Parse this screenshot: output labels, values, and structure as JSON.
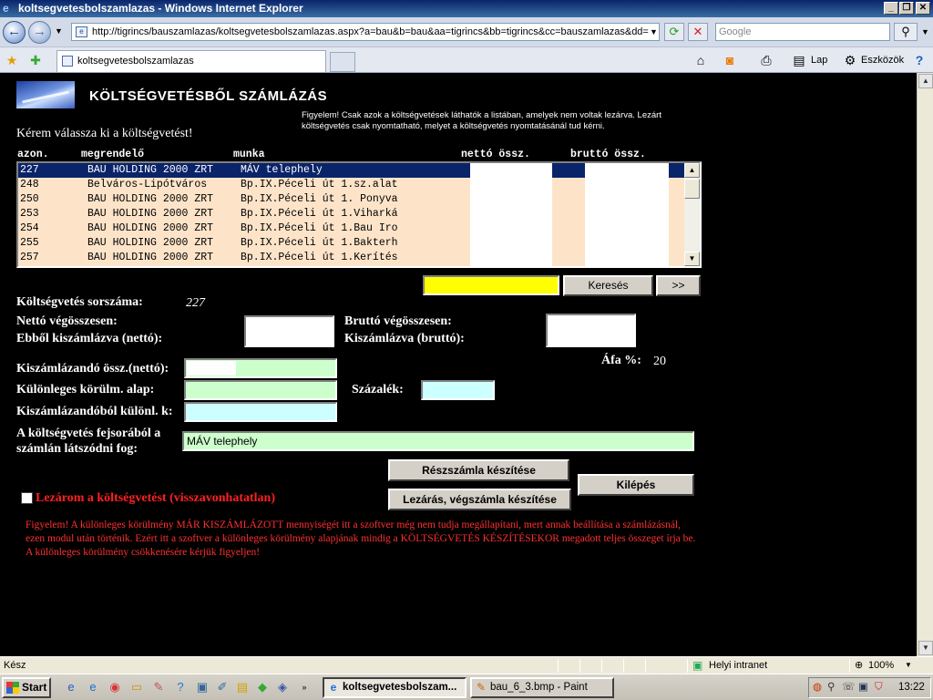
{
  "window": {
    "title": "koltsegvetesbolszamlazas - Windows Internet Explorer"
  },
  "browser": {
    "url": "http://tigrincs/bauszamlazas/koltsegvetesbolszamlazas.aspx?a=bau&b=bau&aa=tigrincs&bb=tigrincs&cc=bauszamlazas&dd=",
    "search_placeholder": "Google",
    "tab_title": "koltsegvetesbolszamlazas",
    "toolbar": {
      "page": "Lap",
      "tools": "Eszközök"
    }
  },
  "page": {
    "title": "KÖLTSÉGVETÉSBŐL SZÁMLÁZÁS",
    "notice": "Figyelem! Csak azok a költségvetések láthatók a listában, amelyek nem voltak lezárva. Lezárt költségvetés csak nyomtatható, melyet a költségvetés nyomtatásánál tud kérni.",
    "choose_prompt": "Kérem válassza ki a költségvetést!",
    "columns": {
      "id": "azon.",
      "customer": "megrendelő",
      "work": "munka",
      "net": "nettó össz.",
      "gross": "bruttó össz."
    },
    "rows": [
      {
        "id": "227",
        "customer": "BAU HOLDING 2000 ZRT",
        "work": "MÁV telephely"
      },
      {
        "id": "248",
        "customer": "Belváros-Lipótváros",
        "work": "Bp.IX.Péceli út 1.sz.alat"
      },
      {
        "id": "250",
        "customer": "BAU HOLDING 2000 ZRT",
        "work": "Bp.IX.Péceli út 1. Ponyva"
      },
      {
        "id": "253",
        "customer": "BAU HOLDING 2000 ZRT",
        "work": "Bp.IX.Péceli út 1.Viharká"
      },
      {
        "id": "254",
        "customer": "BAU HOLDING 2000 ZRT",
        "work": "Bp.IX.Péceli út 1.Bau Iro"
      },
      {
        "id": "255",
        "customer": "BAU HOLDING 2000 ZRT",
        "work": "Bp.IX.Péceli út 1.Bakterh"
      },
      {
        "id": "257",
        "customer": "BAU HOLDING 2000 ZRT",
        "work": "Bp.IX.Péceli út 1.Kerítés"
      }
    ],
    "search_button": "Keresés",
    "next_button": ">>",
    "budget_number_label": "Költségvetés sorszáma:",
    "budget_number_value": "227",
    "net_total_label": "Nettó végösszesen:",
    "net_invoiced_label": "Ebből kiszámlázva (nettó):",
    "gross_total_label": "Bruttó végösszesen:",
    "gross_invoiced_label": "Kiszámlázva (bruttó):",
    "vat_label": "Áfa %:",
    "vat_value": "20",
    "to_invoice_label": "Kiszámlázandó össz.(nettó):",
    "special_base_label": "Különleges körülm. alap:",
    "percent_label": "Százalék:",
    "special_from_label": "Kiszámlázandóból különl. k:",
    "header_text_label": "A költségvetés fejsorából a számlán látszódni fog:",
    "header_text_value": "MÁV telephely",
    "partial_invoice_button": "Részszámla készítése",
    "final_invoice_button": "Lezárás, végszámla készítése",
    "exit_button": "Kilépés",
    "close_checkbox_label": "Lezárom a költségvetést (visszavonhatatlan)",
    "bottom_notice": "Figyelem! A különleges körülmény MÁR KISZÁMLÁZOTT mennyiségét itt a szoftver még nem tudja megállapítani, mert annak beállítása a számlázásnál, ezen modul után történik. Ezért itt a szoftver a különleges körülmény alapjának mindig a KÖLTSÉGVETÉS KÉSZÍTÉSEKOR megadott teljes összeget írja be. A különleges körülmény csökkenésére kérjük figyeljen!"
  },
  "statusbar": {
    "text": "Kész",
    "zone": "Helyi intranet",
    "zoom": "100%"
  },
  "taskbar": {
    "start": "Start",
    "tasks": [
      "koltsegvetesbolszam...",
      "bau_6_3.bmp - Paint"
    ],
    "clock": "13:22"
  },
  "colors": {
    "list_bg": "#fde4c9",
    "selected": "#0a246a",
    "search_field": "#ffff00",
    "green_field": "#ccffcc",
    "blue_field": "#ccffff",
    "warning": "#ff2020"
  }
}
